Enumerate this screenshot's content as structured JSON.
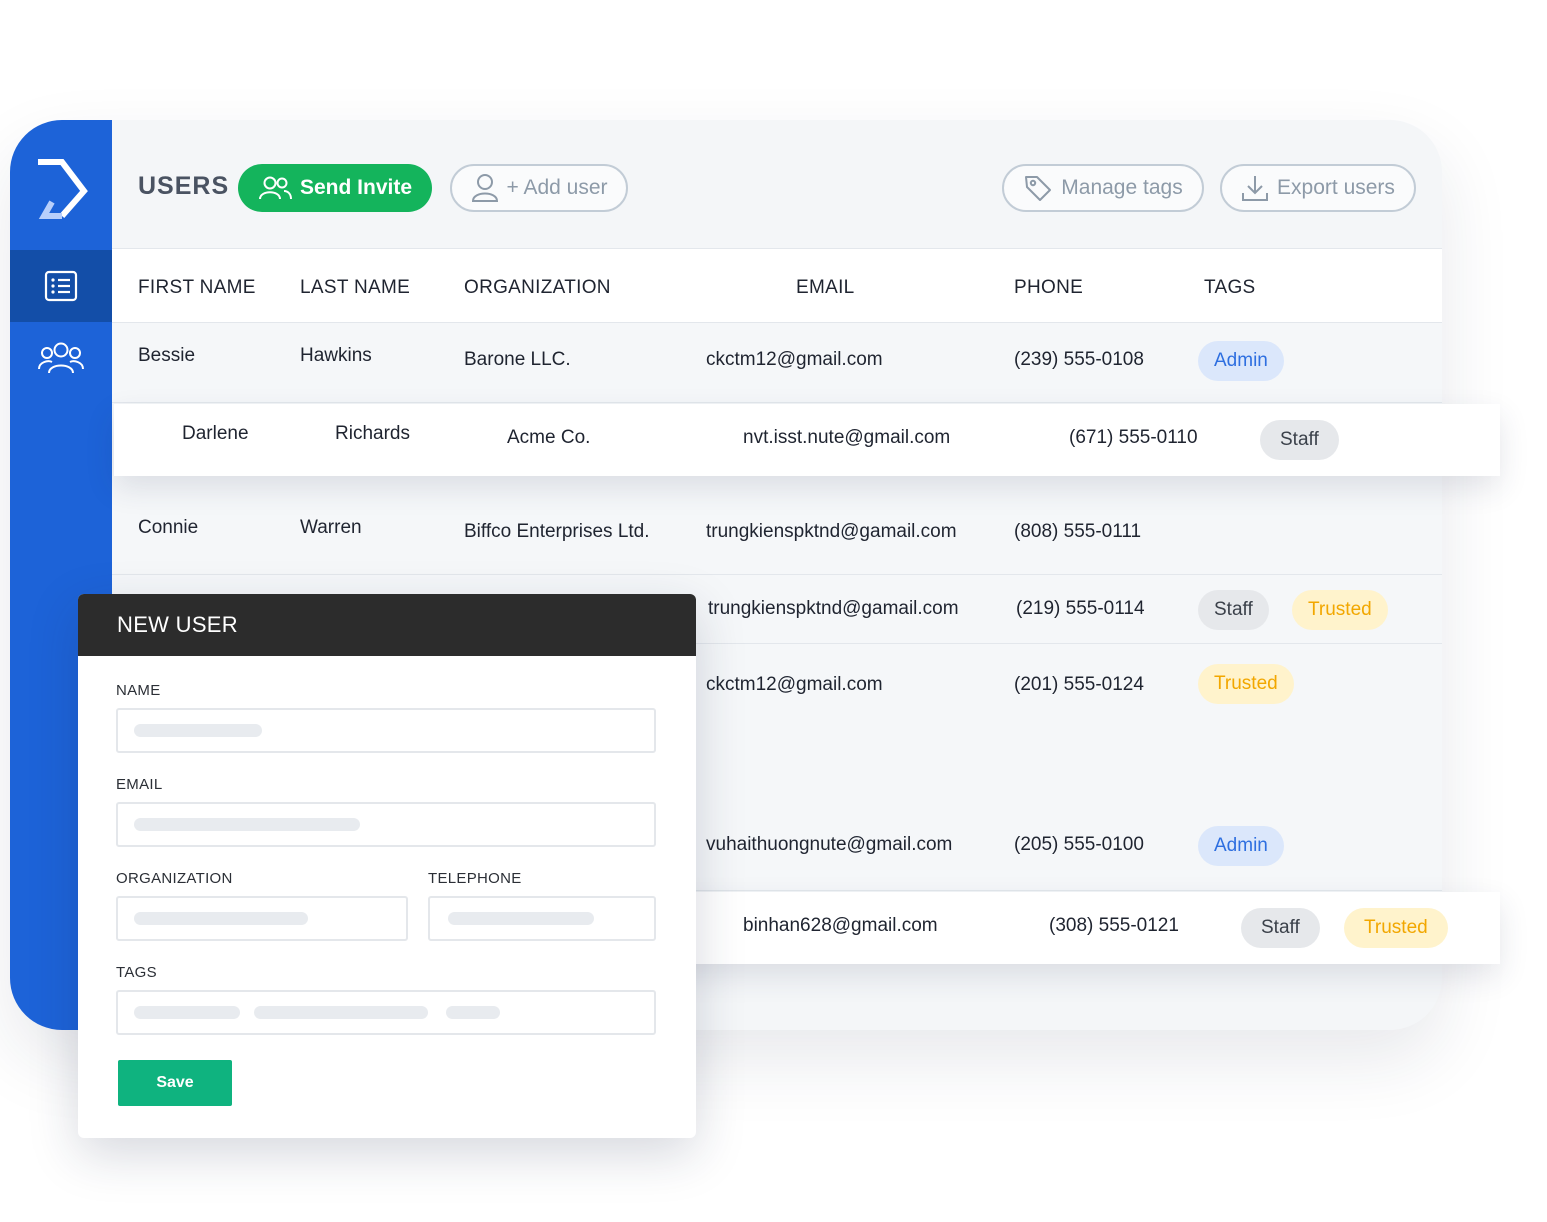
{
  "toolbar": {
    "title": "USERS",
    "send_invite_label": "Send Invite",
    "add_user_label": "+ Add user",
    "manage_tags_label": "Manage tags",
    "export_users_label": "Export users"
  },
  "table": {
    "columns": [
      "FIRST NAME",
      "LAST NAME",
      "ORGANIZATION",
      "EMAIL",
      "PHONE",
      "TAGS"
    ],
    "rows": [
      {
        "first": "Bessie",
        "last": "Hawkins",
        "org": "Barone LLC.",
        "email": "ckctm12@gmail.com",
        "phone": "(239) 555-0108",
        "tags": [
          "Admin"
        ]
      },
      {
        "first": "Darlene",
        "last": "Richards",
        "org": "Acme Co.",
        "email": "nvt.isst.nute@gmail.com",
        "phone": "(671) 555-0110",
        "tags": [
          "Staff"
        ]
      },
      {
        "first": "Connie",
        "last": "Warren",
        "org": "Biffco Enterprises Ltd.",
        "email": "trungkienspktnd@gamail.com",
        "phone": "(808) 555-0111",
        "tags": []
      },
      {
        "email": "trungkienspktnd@gamail.com",
        "phone": "(219) 555-0114",
        "tags": [
          "Staff",
          "Trusted"
        ]
      },
      {
        "email": "ckctm12@gmail.com",
        "phone": "(201) 555-0124",
        "tags": [
          "Trusted"
        ]
      },
      {
        "email": "vuhaithuongnute@gmail.com",
        "phone": "(205) 555-0100",
        "tags": [
          "Admin"
        ]
      },
      {
        "email": "binhan628@gmail.com",
        "phone": "(308) 555-0121",
        "tags": [
          "Staff",
          "Trusted"
        ]
      }
    ]
  },
  "modal": {
    "title": "NEW USER",
    "name_label": "NAME",
    "email_label": "EMAIL",
    "organization_label": "ORGANIZATION",
    "telephone_label": "TELEPHONE",
    "tags_label": "TAGS",
    "save_label": "Save"
  },
  "colors": {
    "sidebar": "#1d63d8",
    "primary": "#14b45c",
    "save": "#0fb37f",
    "admin_tag": "#2e6fe0",
    "trusted_tag": "#f2a700"
  },
  "icons": {
    "logo": "logo-icon",
    "list": "list-icon",
    "users": "users-icon",
    "send_invite": "users-icon",
    "add_user": "user-icon",
    "manage_tags": "tag-icon",
    "export_users": "download-icon"
  }
}
